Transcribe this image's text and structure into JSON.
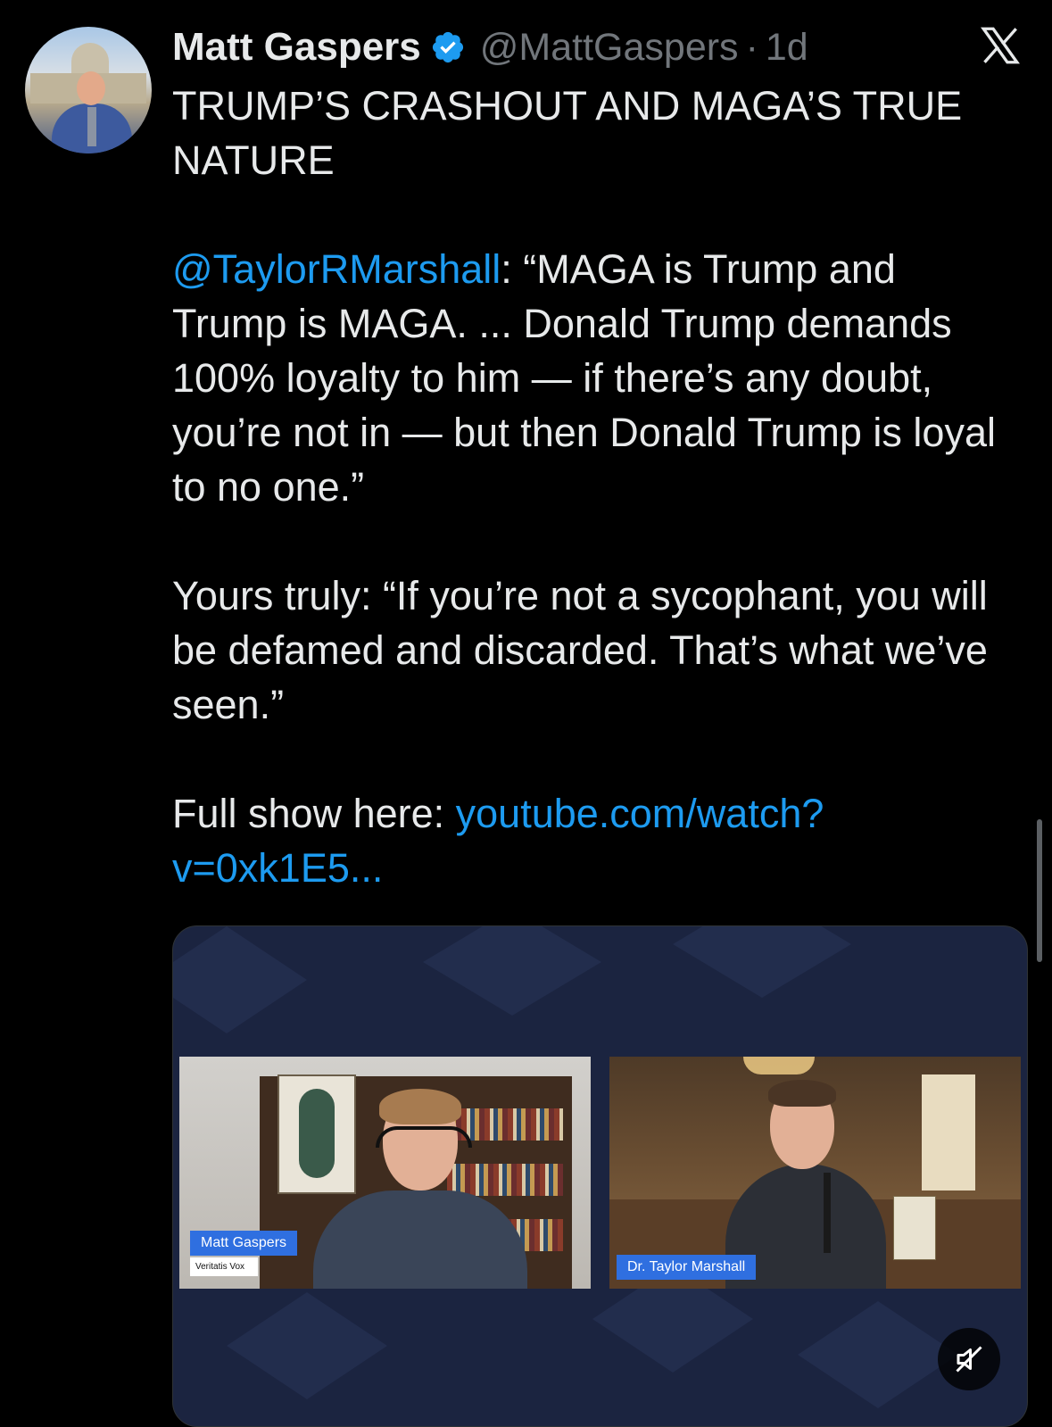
{
  "post": {
    "author_name": "Matt Gaspers",
    "author_handle": "@MattGaspers",
    "separator": "·",
    "timestamp": "1d",
    "verified": true,
    "paragraph1": "TRUMP’S CRASHOUT AND MAGA’S TRUE NATURE",
    "mention": "@TaylorRMarshall",
    "paragraph2_rest": ": “MAGA is Trump and Trump is MAGA. ... Donald Trump demands 100% loyalty to him — if there’s any doubt, you’re not in — but then Donald Trump is loyal to no one.”",
    "paragraph3": "Yours truly: “If you’re not a sycophant, you will be defamed and discarded. That’s what we’ve seen.”",
    "paragraph4_prefix": "Full show here: ",
    "link_text": "youtube.com/watch?v=0xk1E5...",
    "link_text_line1": "youtube.com/watch?",
    "link_text_line2": "v=0xk1E5..."
  },
  "media": {
    "left_speaker_name": "Matt Gaspers",
    "left_speaker_subtitle": "Veritatis Vox",
    "right_speaker_name": "Dr. Taylor Marshall",
    "mute_icon": "speaker-muted-icon"
  },
  "colors": {
    "background": "#000000",
    "text": "#e7e9ea",
    "secondary_text": "#71767b",
    "link": "#1d9bf0",
    "verified_badge": "#1d9bf0",
    "media_background": "#1b2440",
    "name_tag": "#2f6fe0"
  }
}
